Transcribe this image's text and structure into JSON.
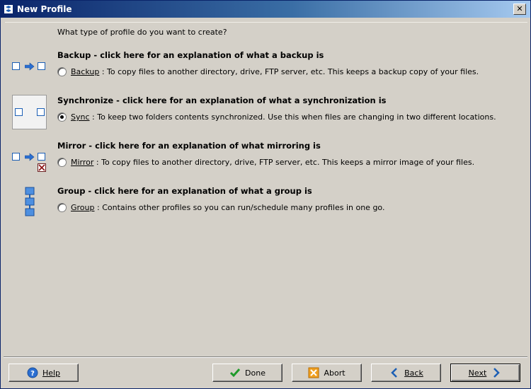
{
  "window": {
    "title": "New Profile"
  },
  "question": "What type of profile do you want to create?",
  "sections": [
    {
      "title": "Backup - click here for an explanation of what a backup is",
      "option_label": "Backup",
      "option_desc": " : To copy files to another directory, drive, FTP server, etc. This keeps a backup copy of your files.",
      "checked": false,
      "icon": "backup-icon"
    },
    {
      "title": "Synchronize - click here for an explanation of what a synchronization is",
      "option_label": "Sync",
      "option_desc": " : To keep two folders contents synchronized. Use this when files are changing in two different locations.",
      "checked": true,
      "icon": "sync-icon"
    },
    {
      "title": "Mirror - click here for an explanation of what mirroring is",
      "option_label": "Mirror",
      "option_desc": " : To copy files to another directory, drive, FTP server, etc. This keeps a mirror image of your files.",
      "checked": false,
      "icon": "mirror-icon"
    },
    {
      "title": "Group - click here for an explanation of what a group is",
      "option_label": "Group",
      "option_desc": " : Contains other profiles so you can run/schedule many profiles in one go.",
      "checked": false,
      "icon": "group-icon"
    }
  ],
  "buttons": {
    "help": "Help",
    "done": "Done",
    "abort": "Abort",
    "back": "Back",
    "next": "Next"
  },
  "colors": {
    "title_start": "#0a246a",
    "title_end": "#a6caf0",
    "face": "#d4d0c8",
    "icon_blue": "#1c5fb5"
  }
}
